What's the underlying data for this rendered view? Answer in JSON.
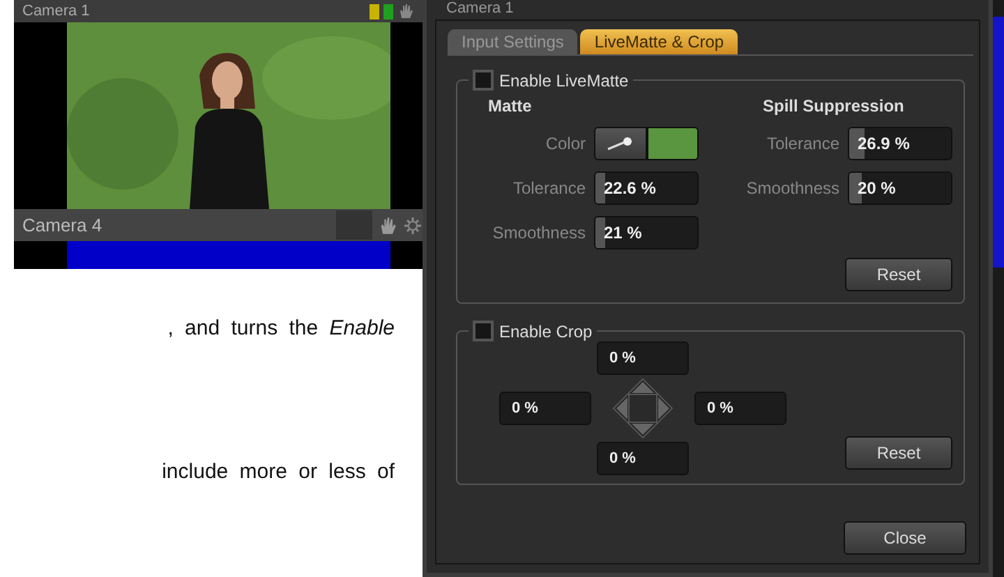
{
  "monitor": {
    "top_label": "Camera 1",
    "bottom_label": "Camera 4"
  },
  "paragraphs": [
    {
      "text": ", and turns the *Enable*"
    },
    {
      "text": "include more or less of"
    }
  ],
  "dialog": {
    "title": "Camera 1",
    "tabs": [
      {
        "label": "Input Settings",
        "selected": false
      },
      {
        "label": "LiveMatte & Crop",
        "selected": true
      }
    ],
    "livematte": {
      "label": "Enable LiveMatte",
      "checked": false,
      "matte_heading": "Matte",
      "spill_heading": "Spill Suppression",
      "color_label": "Color",
      "matte_fields": [
        {
          "label": "Tolerance",
          "value": "22.6 %",
          "level": 0.1
        },
        {
          "label": "Smoothness",
          "value": "21 %",
          "level": 0.1
        }
      ],
      "spill_fields": [
        {
          "label": "Tolerance",
          "value": "26.9 %",
          "level": 0.15
        },
        {
          "label": "Smoothness",
          "value": "20 %",
          "level": 0.12
        }
      ],
      "reset": "Reset"
    },
    "crop": {
      "label": "Enable Crop",
      "checked": false,
      "values": [
        "0 %",
        "0 %",
        "0 %",
        "0 %"
      ],
      "reset": "Reset"
    },
    "close": "Close"
  }
}
